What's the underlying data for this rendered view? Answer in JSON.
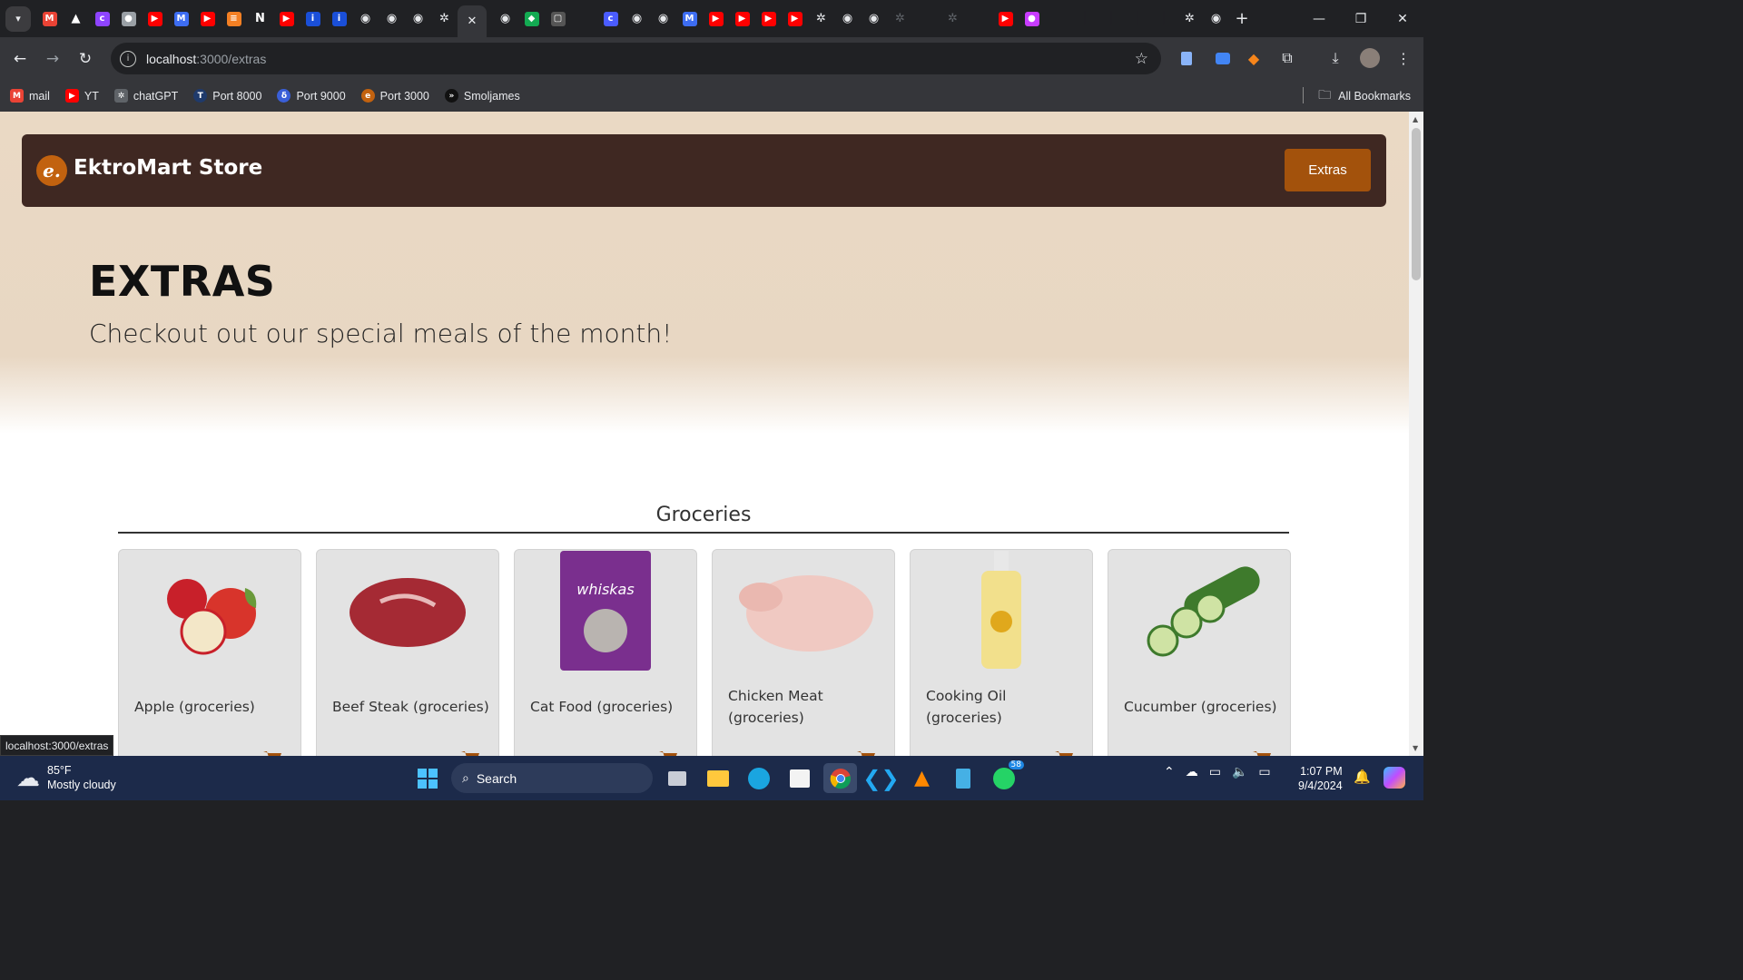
{
  "browser": {
    "tabs": [
      {
        "icon": "gmail-icon",
        "color": "#ea4335",
        "glyph": "M"
      },
      {
        "icon": "drive-icon",
        "color": "#ffffff",
        "glyph": "▲"
      },
      {
        "icon": "app-icon",
        "color": "#8e44ff",
        "glyph": "c"
      },
      {
        "icon": "drop-icon",
        "color": "#9aa0a6",
        "glyph": "●"
      },
      {
        "icon": "youtube-icon",
        "color": "#ff0000",
        "glyph": "▶"
      },
      {
        "icon": "app-icon",
        "color": "#3d6df2",
        "glyph": "M"
      },
      {
        "icon": "youtube-icon",
        "color": "#ff0000",
        "glyph": "▶"
      },
      {
        "icon": "stackoverflow-icon",
        "color": "#f48024",
        "glyph": "≡"
      },
      {
        "icon": "notion-icon",
        "color": "#ffffff",
        "glyph": "N"
      },
      {
        "icon": "youtube-icon",
        "color": "#ff0000",
        "glyph": "▶"
      },
      {
        "icon": "info-icon",
        "color": "#1a4fd8",
        "glyph": "i"
      },
      {
        "icon": "info-icon",
        "color": "#1a4fd8",
        "glyph": "i"
      },
      {
        "icon": "globe-icon",
        "color": "#e8eaed",
        "glyph": "◉"
      },
      {
        "icon": "globe-icon",
        "color": "#e8eaed",
        "glyph": "◉"
      },
      {
        "icon": "globe-icon",
        "color": "#e8eaed",
        "glyph": "◉"
      },
      {
        "icon": "chatgpt-icon",
        "color": "#e8eaed",
        "glyph": "✲"
      }
    ],
    "tabs_after": [
      {
        "icon": "globe-icon",
        "color": "#e8eaed",
        "glyph": "◉"
      },
      {
        "icon": "mongodb-icon",
        "color": "#13aa52",
        "glyph": "◆"
      },
      {
        "icon": "app-icon",
        "color": "#555555",
        "glyph": "▢"
      },
      {
        "icon": "blank-icon",
        "color": "#202124",
        "glyph": ""
      },
      {
        "icon": "app-icon",
        "color": "#4a5cff",
        "glyph": "c"
      },
      {
        "icon": "globe-icon",
        "color": "#e8eaed",
        "glyph": "◉"
      },
      {
        "icon": "globe-icon",
        "color": "#e8eaed",
        "glyph": "◉"
      },
      {
        "icon": "app-icon",
        "color": "#3d6df2",
        "glyph": "M"
      },
      {
        "icon": "youtube-icon",
        "color": "#ff0000",
        "glyph": "▶"
      },
      {
        "icon": "youtube-icon",
        "color": "#ff0000",
        "glyph": "▶"
      },
      {
        "icon": "youtube-icon",
        "color": "#ff0000",
        "glyph": "▶"
      },
      {
        "icon": "youtube-icon",
        "color": "#ff0000",
        "glyph": "▶"
      },
      {
        "icon": "chatgpt-icon",
        "color": "#e8eaed",
        "glyph": "✲"
      },
      {
        "icon": "globe-icon",
        "color": "#e8eaed",
        "glyph": "◉"
      },
      {
        "icon": "globe-icon",
        "color": "#e8eaed",
        "glyph": "◉"
      },
      {
        "icon": "chatgpt-icon",
        "color": "#5f6368",
        "glyph": "✲"
      },
      {
        "icon": "blank-icon",
        "color": "#202124",
        "glyph": ""
      },
      {
        "icon": "chatgpt-icon",
        "color": "#5f6368",
        "glyph": "✲"
      },
      {
        "icon": "blank-icon",
        "color": "#202124",
        "glyph": ""
      },
      {
        "icon": "youtube-icon",
        "color": "#ff0000",
        "glyph": "▶"
      },
      {
        "icon": "app-icon",
        "color": "#c83cff",
        "glyph": "●"
      },
      {
        "icon": "blank-icon",
        "color": "#202124",
        "glyph": ""
      },
      {
        "icon": "blank-icon",
        "color": "#202124",
        "glyph": "│"
      },
      {
        "icon": "blank-icon",
        "color": "#202124",
        "glyph": "│"
      },
      {
        "icon": "blank-icon",
        "color": "#202124",
        "glyph": "│"
      },
      {
        "icon": "blank-icon",
        "color": "#202124",
        "glyph": "│"
      },
      {
        "icon": "chatgpt-icon",
        "color": "#e8eaed",
        "glyph": "✲"
      },
      {
        "icon": "globe-icon",
        "color": "#e8eaed",
        "glyph": "◉"
      }
    ],
    "url_host": "localhost",
    "url_path": ":3000/extras",
    "status_url": "localhost:3000/extras",
    "bookmarks": [
      {
        "label": "mail",
        "icon": "gmail-icon",
        "color": "#ea4335",
        "glyph": "M"
      },
      {
        "label": "YT",
        "icon": "youtube-icon",
        "color": "#ff0000",
        "glyph": "▶"
      },
      {
        "label": "chatGPT",
        "icon": "chatgpt-icon",
        "color": "#5f6368",
        "glyph": "✲"
      },
      {
        "label": "Port 8000",
        "icon": "port-icon",
        "color": "#1f3a6b",
        "glyph": "T"
      },
      {
        "label": "Port 9000",
        "icon": "port-icon",
        "color": "#3a5fd8",
        "glyph": "δ"
      },
      {
        "label": "Port 3000",
        "icon": "port-icon",
        "color": "#c2620f",
        "glyph": "e"
      },
      {
        "label": "Smoljames",
        "icon": "port-icon",
        "color": "#111111",
        "glyph": "»"
      }
    ],
    "all_bookmarks": "All Bookmarks"
  },
  "page": {
    "brand_logo": "e.",
    "brand_name": "EktroMart Store",
    "nav_button": "Extras",
    "hero_title": "EXTRAS",
    "hero_subtitle": "Checkout out our special meals of the month!",
    "section_title": "Groceries",
    "products": [
      {
        "name": "Apple (groceries)",
        "image": "apple-image"
      },
      {
        "name": "Beef Steak (groceries)",
        "image": "beef-image"
      },
      {
        "name": "Cat Food (groceries)",
        "image": "catfood-image"
      },
      {
        "name": "Chicken Meat (groceries)",
        "image": "chicken-image"
      },
      {
        "name": "Cooking Oil (groceries)",
        "image": "oil-image"
      },
      {
        "name": "Cucumber (groceries)",
        "image": "cucumber-image"
      }
    ]
  },
  "taskbar": {
    "temperature": "85°F",
    "weather": "Mostly cloudy",
    "search": "Search",
    "time": "1:07 PM",
    "date": "9/4/2024",
    "whatsapp_badge": "58"
  },
  "colors": {
    "navbar": "#3f2822",
    "accent": "#a3520c",
    "logo": "#c2620f"
  }
}
